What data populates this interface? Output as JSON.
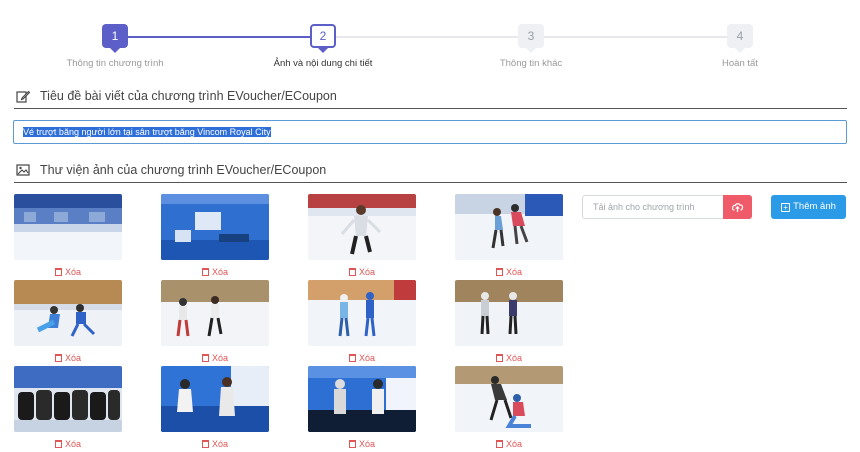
{
  "stepper": {
    "steps": [
      {
        "num": "1",
        "label": "Thông tin chương trình"
      },
      {
        "num": "2",
        "label": "Ảnh và nội dung chi tiết"
      },
      {
        "num": "3",
        "label": "Thông tin khác"
      },
      {
        "num": "4",
        "label": "Hoàn tất"
      }
    ]
  },
  "title_section": {
    "heading": "Tiêu đề bài viết của chương trình EVoucher/ECoupon",
    "value": "Vé trượt băng người lớn tại sân trượt băng Vincom Royal City"
  },
  "gallery_section": {
    "heading": "Thư viện ảnh của chương trình EVoucher/ECoupon",
    "delete_label": "Xóa",
    "images": [
      {
        "icon": "ice-rink-photo"
      },
      {
        "icon": "rink-lobby-photo"
      },
      {
        "icon": "skater-photo"
      },
      {
        "icon": "skater-photo"
      },
      {
        "icon": "skater-photo"
      },
      {
        "icon": "skater-photo"
      },
      {
        "icon": "skater-photo"
      },
      {
        "icon": "skater-photo"
      },
      {
        "icon": "skate-rental-photo"
      },
      {
        "icon": "counter-photo"
      },
      {
        "icon": "counter-photo"
      },
      {
        "icon": "skater-photo"
      }
    ],
    "upload_placeholder": "Tải ảnh cho chương trình",
    "add_button": "Thêm ảnh"
  },
  "colors": {
    "accent": "#5b5fc7",
    "danger": "#f05b6a",
    "primary": "#2b9be8"
  }
}
